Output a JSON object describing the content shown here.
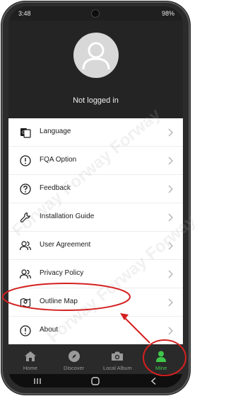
{
  "status_bar": {
    "time": "3:48",
    "battery": "98%"
  },
  "profile": {
    "login_status": "Not logged in"
  },
  "menu": {
    "items": [
      {
        "label": "Language"
      },
      {
        "label": "FQA Option"
      },
      {
        "label": "Feedback"
      },
      {
        "label": "Installation Guide"
      },
      {
        "label": "User Agreement"
      },
      {
        "label": "Privacy Policy"
      },
      {
        "label": "Outline Map"
      },
      {
        "label": "About"
      }
    ]
  },
  "bottom_nav": {
    "items": [
      {
        "label": "Home"
      },
      {
        "label": "Discover"
      },
      {
        "label": "Local Album"
      },
      {
        "label": "Mine"
      }
    ],
    "active": "Mine"
  },
  "colors": {
    "accent": "#3ec84a",
    "annotation": "#d42020"
  },
  "watermark_text": "Forway Forway Forway"
}
